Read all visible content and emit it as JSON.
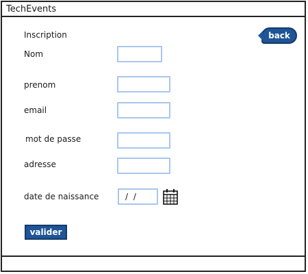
{
  "window": {
    "title": "TechEvents"
  },
  "form": {
    "heading": "Inscription",
    "back_label": "back",
    "fields": {
      "nom": {
        "label": "Nom",
        "value": ""
      },
      "prenom": {
        "label": "prenom",
        "value": ""
      },
      "email": {
        "label": "email",
        "value": ""
      },
      "password": {
        "label": "mot de passe",
        "value": ""
      },
      "adresse": {
        "label": "adresse",
        "value": ""
      },
      "birthdate": {
        "label": "date de naissance",
        "value": "/ /"
      }
    },
    "submit_label": "valider"
  },
  "icons": {
    "calendar": "calendar-icon",
    "back": "back-arrow-button"
  },
  "colors": {
    "accent": "#1f5597",
    "field_border": "#a8c6ef"
  }
}
